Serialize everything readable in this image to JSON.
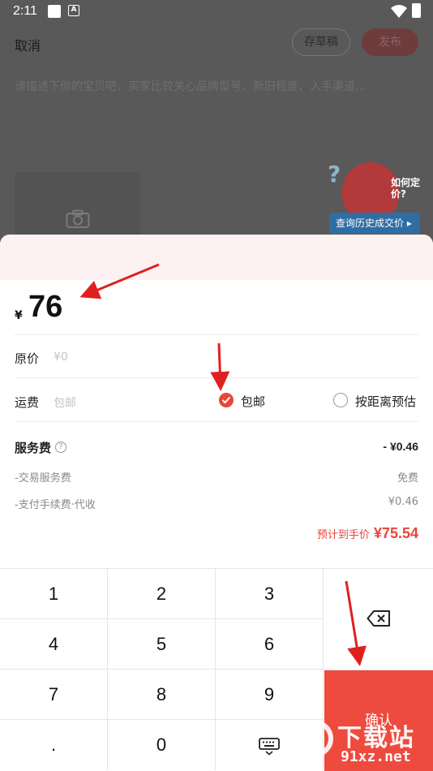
{
  "status_bar": {
    "time": "2:11",
    "notif_glyph": "A"
  },
  "top_bar": {
    "cancel": "取消",
    "save_draft": "存草稿",
    "publish": "发布"
  },
  "description": {
    "placeholder": "请描述下你的宝贝吧，买家比较关心品牌型号、新旧程度、入手渠道..."
  },
  "mascot": {
    "question": "如何定价?",
    "history_button": "查询历史成交价 ▸"
  },
  "price_sheet": {
    "currency": "¥",
    "price": "76",
    "original_price": {
      "label": "原价",
      "placeholder": "¥0"
    },
    "shipping": {
      "label": "运费",
      "placeholder": "包邮",
      "options": [
        {
          "label": "包邮",
          "selected": true
        },
        {
          "label": "按距离预估",
          "selected": false
        }
      ]
    },
    "service_fee": {
      "title": "服务费",
      "help": "?",
      "total": "- ¥0.46",
      "items": [
        {
          "label": "-交易服务费",
          "value": "免费"
        },
        {
          "label": "-支付手续费·代收",
          "value": "¥0.46"
        }
      ]
    },
    "net": {
      "label": "预计到手价",
      "amount": "¥75.54"
    }
  },
  "keypad": {
    "keys": [
      "1",
      "2",
      "3",
      "4",
      "5",
      "6",
      "7",
      "8",
      "9",
      ".",
      "0"
    ],
    "confirm": "确认"
  },
  "watermark": {
    "name": "下载站",
    "url": "91xz.net"
  },
  "colors": {
    "accent": "#ee4a3e",
    "check": "#e8453c",
    "arrow": "#e02020"
  }
}
